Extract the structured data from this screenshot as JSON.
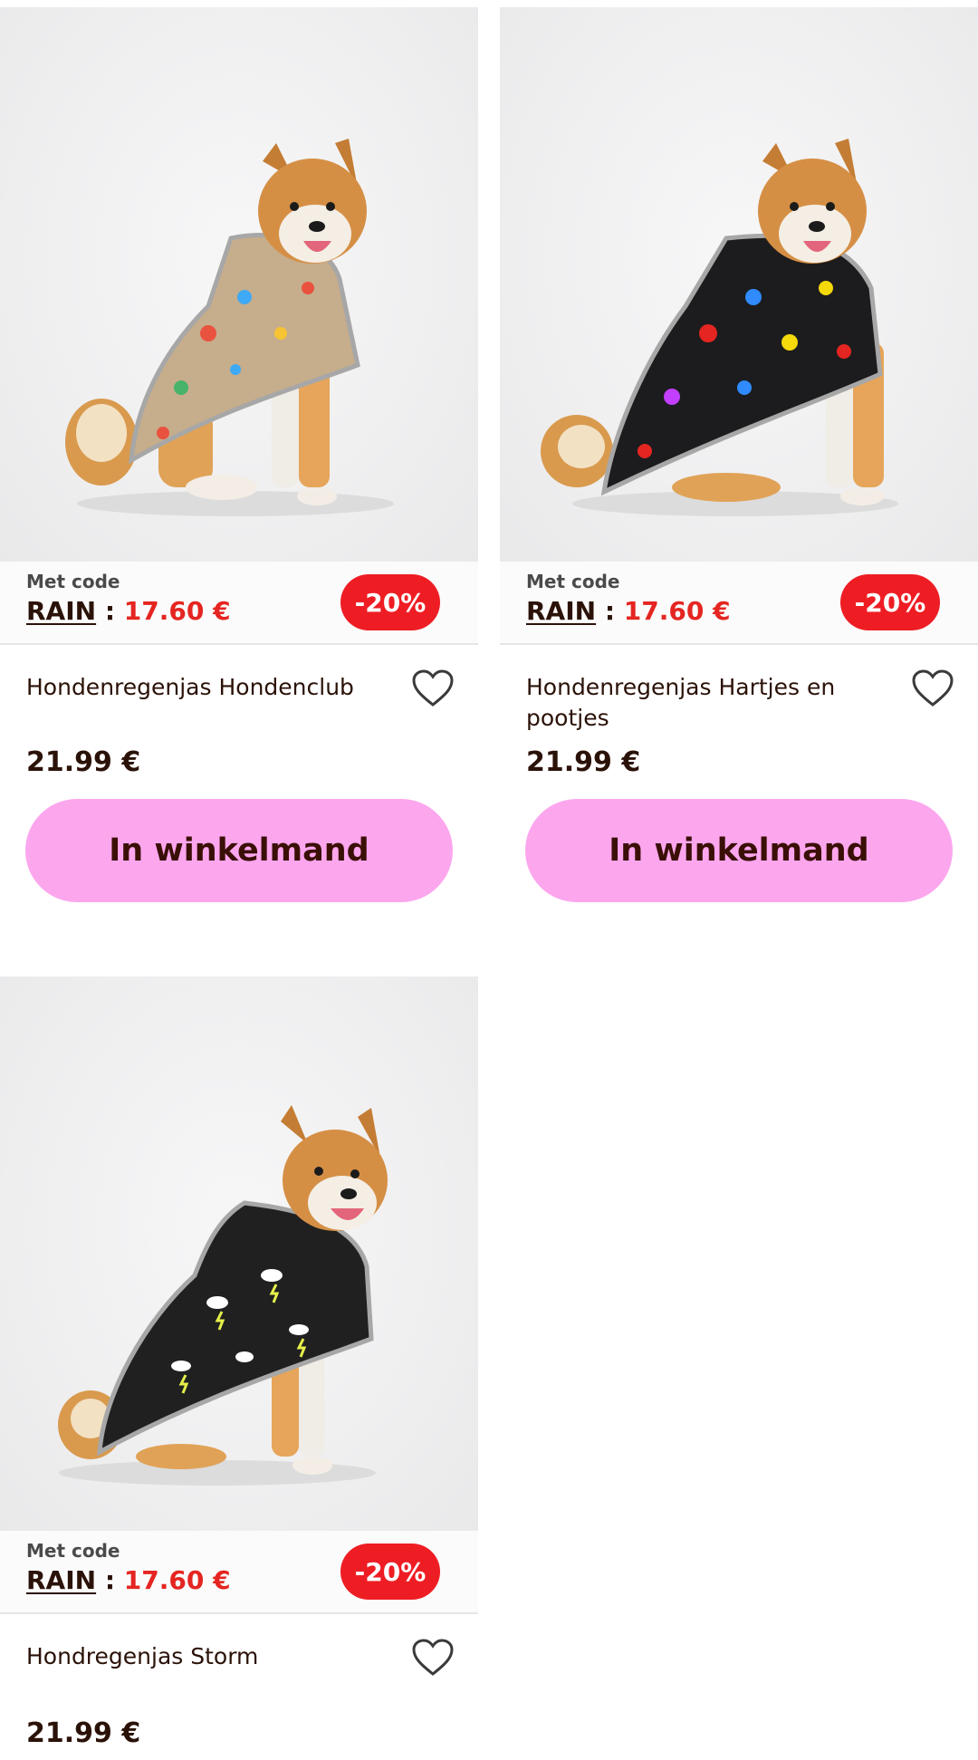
{
  "products": [
    {
      "image_alt": "Shiba Inu dog wearing beige raincoat with colorful dog-club print",
      "coat_color": "#c6ad8b",
      "pattern_colors": [
        "#e9523f",
        "#3fa9f5",
        "#f6c333",
        "#47b36b"
      ],
      "promo_label": "Met code",
      "code": "RAIN",
      "separator": ":",
      "discount_price": "17.60 €",
      "badge": "-20%",
      "title": "Hondenregenjas Hondenclub",
      "price": "21.99 €",
      "cart_label": "In winkelmand",
      "favorite_icon": "heart-outline-icon"
    },
    {
      "image_alt": "Shiba Inu dog wearing black raincoat with colorful paws and balls print",
      "coat_color": "#1c1c1e",
      "pattern_colors": [
        "#e52521",
        "#2f8bff",
        "#f5d90a",
        "#c23fff"
      ],
      "promo_label": "Met code",
      "code": "RAIN",
      "separator": ":",
      "discount_price": "17.60 €",
      "badge": "-20%",
      "title": "Hondenregenjas Hartjes en pootjes",
      "price": "21.99 €",
      "cart_label": "In winkelmand",
      "favorite_icon": "heart-outline-icon"
    },
    {
      "image_alt": "Shiba Inu dog wearing black raincoat with cloud and lightning storm print",
      "coat_color": "#202020",
      "pattern_colors": [
        "#ffffff",
        "#e6f04a"
      ],
      "promo_label": "Met code",
      "code": "RAIN",
      "separator": ":",
      "discount_price": "17.60 €",
      "badge": "-20%",
      "title": "Hondregenjas Storm",
      "price": "21.99 €",
      "favorite_icon": "heart-outline-icon"
    }
  ],
  "colors": {
    "brand_text": "#2b1208",
    "discount_red": "#e52521",
    "badge_red": "#ee1d24",
    "cart_pink": "#fca6ee"
  }
}
